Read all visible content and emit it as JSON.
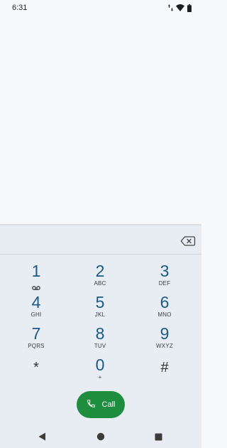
{
  "status_bar": {
    "time": "6:31",
    "icons": [
      "data-arrows-icon",
      "wifi-icon",
      "battery-icon"
    ]
  },
  "dialpad": {
    "entered_digits": "",
    "keys": [
      {
        "digit": "1",
        "letters": "",
        "icon": "voicemail-icon"
      },
      {
        "digit": "2",
        "letters": "ABC"
      },
      {
        "digit": "3",
        "letters": "DEF"
      },
      {
        "digit": "4",
        "letters": "GHI"
      },
      {
        "digit": "5",
        "letters": "JKL"
      },
      {
        "digit": "6",
        "letters": "MNO"
      },
      {
        "digit": "7",
        "letters": "PQRS"
      },
      {
        "digit": "8",
        "letters": "TUV"
      },
      {
        "digit": "9",
        "letters": "WXYZ"
      },
      {
        "digit": "*",
        "letters": ""
      },
      {
        "digit": "0",
        "letters": "+"
      },
      {
        "digit": "#",
        "letters": ""
      }
    ]
  },
  "call_button": {
    "label": "Call",
    "color": "#1e8e3e"
  },
  "colors": {
    "digit": "#1b5a86",
    "panel_background": "#e8ecf3",
    "page_background": "#f8f9fc"
  }
}
